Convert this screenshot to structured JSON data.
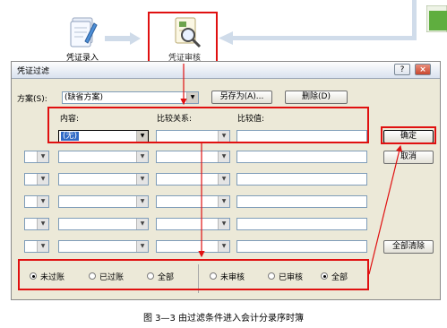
{
  "workflow": {
    "step1_label": "凭证录入",
    "step2_label": "凭证审核"
  },
  "dialog": {
    "title": "凭证过滤",
    "help_button": "?",
    "close_button": "×",
    "scheme_label": "方案(S):",
    "scheme_value": "(缺省方案)",
    "save_as_button": "另存为(A)...",
    "delete_button": "删除(D)",
    "headers": {
      "content": "内容:",
      "relation": "比较关系:",
      "value": "比较值:"
    },
    "first_row_content": "(无)",
    "confirm_button": "确定",
    "cancel_button": "取消",
    "clear_all_button": "全部清除",
    "posting_options": [
      "未过账",
      "已过账",
      "全部"
    ],
    "posting_selected": "未过账",
    "audit_options": [
      "未审核",
      "已审核",
      "全部"
    ],
    "audit_selected": "全部"
  },
  "caption": "图 3—3  由过滤条件进入会计分录序时簿",
  "colors": {
    "highlight_red": "#e01010",
    "selection_blue": "#316ac5",
    "dialog_bg": "#ece9d8"
  }
}
